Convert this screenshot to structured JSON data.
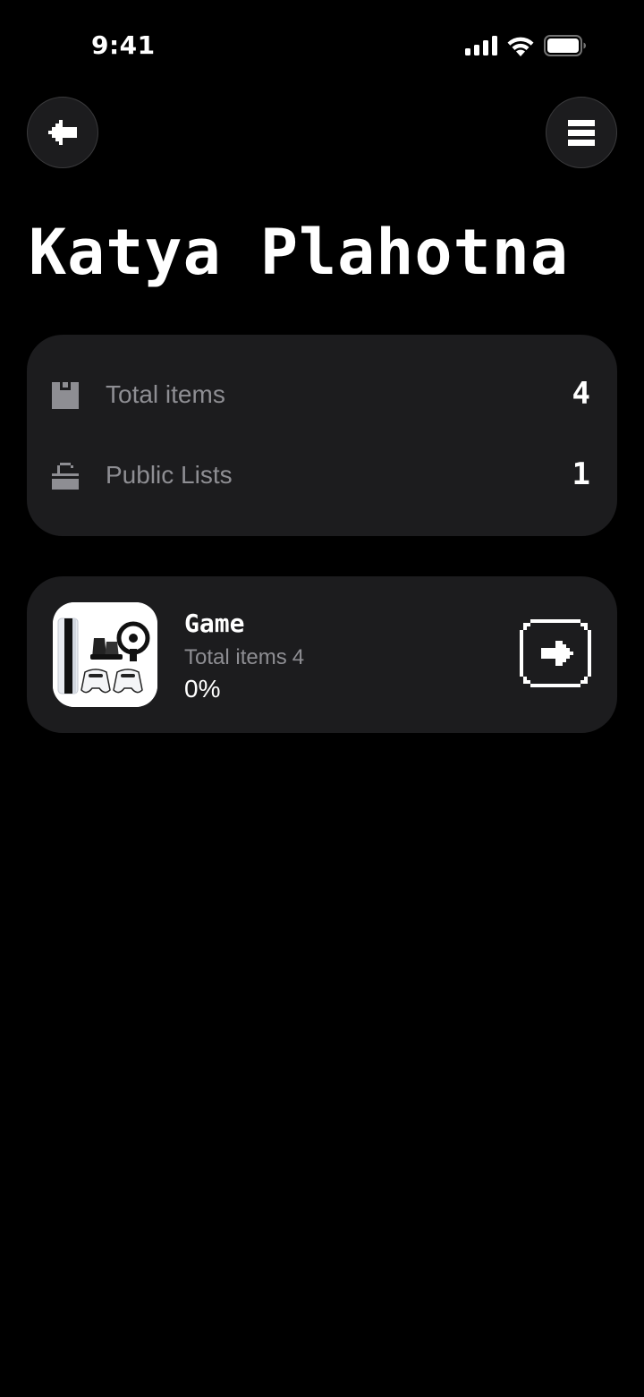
{
  "status_bar": {
    "time": "9:41",
    "icons": [
      "cellular-signal-icon",
      "wifi-icon",
      "battery-icon"
    ]
  },
  "header": {
    "back_icon": "arrow-left-icon",
    "menu_icon": "hamburger-menu-icon",
    "title": "Katya Plahotna"
  },
  "stats": {
    "items": [
      {
        "icon": "box-icon",
        "label": "Total items",
        "value": "4"
      },
      {
        "icon": "unlock-icon",
        "label": "Public Lists",
        "value": "1"
      }
    ]
  },
  "lists": [
    {
      "thumbnail": "console-bundle-image",
      "name": "Game",
      "count_label": "Total items",
      "count_value": "4",
      "progress": "0%",
      "open_icon": "arrow-right-icon"
    }
  ],
  "colors": {
    "background": "#000000",
    "card": "#1c1c1e",
    "muted_text": "#8e8e93",
    "text": "#ffffff"
  }
}
